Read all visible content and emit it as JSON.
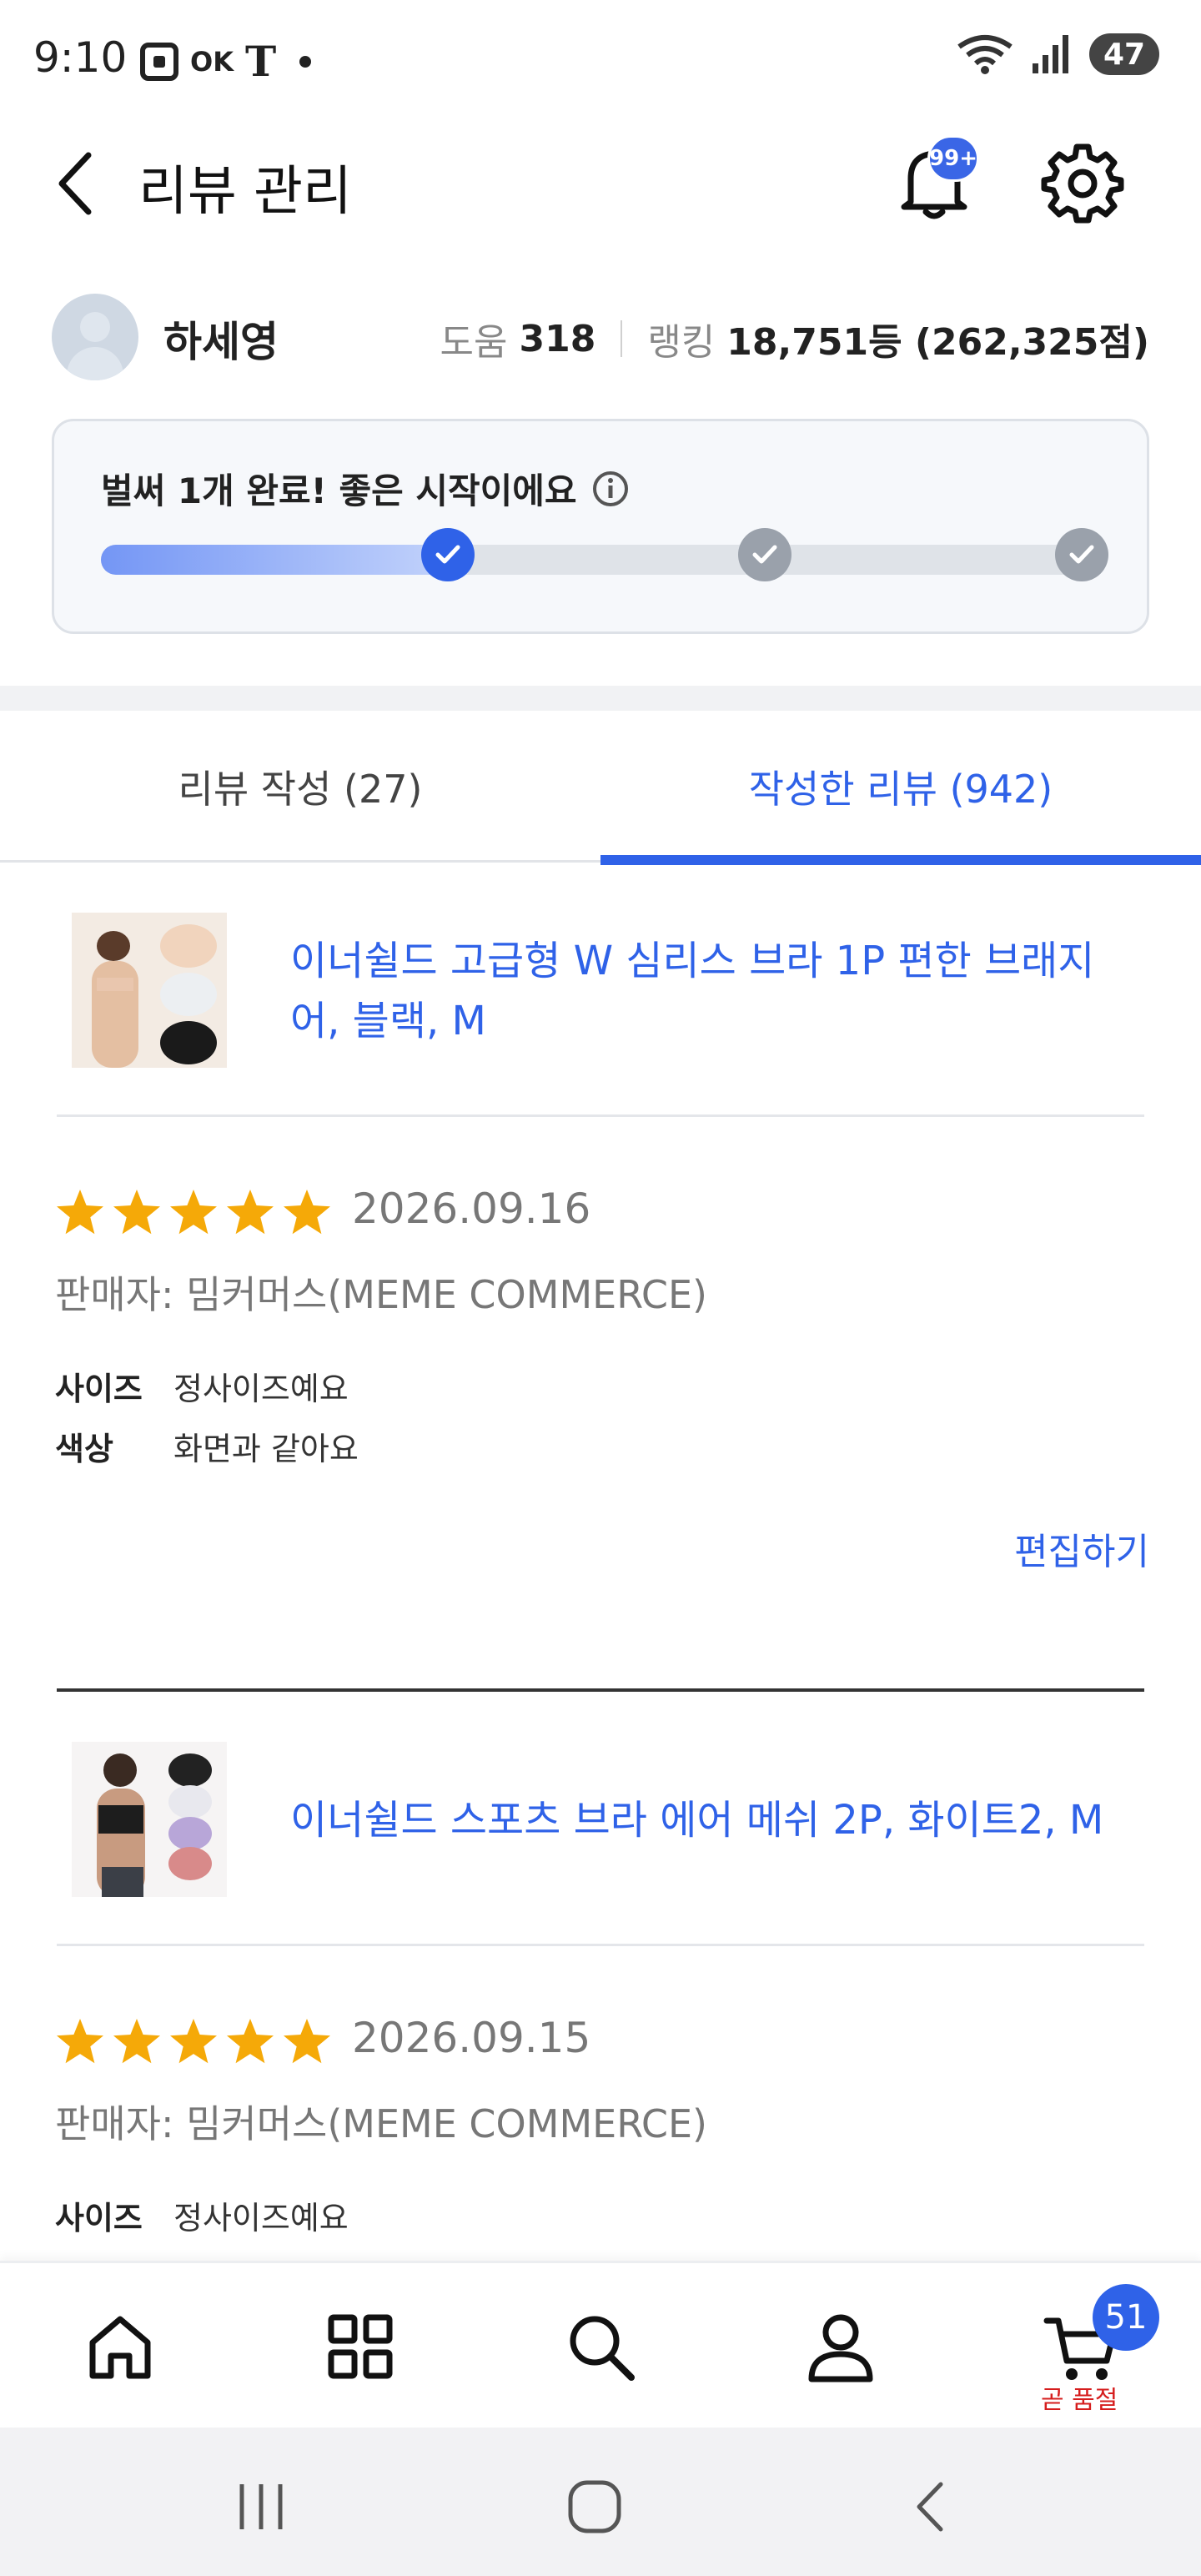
{
  "status_bar": {
    "time": "9:10",
    "icons_left": [
      "screenshot-icon",
      "ok-icon",
      "t-icon",
      "dot-icon"
    ],
    "ok_text": "OK",
    "t_text": "T",
    "battery": "47",
    "icons_right": [
      "wifi-icon",
      "signal-icon",
      "battery-icon"
    ]
  },
  "header": {
    "title": "리뷰 관리",
    "notification_badge": "99+"
  },
  "profile": {
    "name": "하세영",
    "help_label": "도움",
    "help_value": "318",
    "ranking_label": "랭킹",
    "ranking_value": "18,751등 (262,325점)"
  },
  "progress": {
    "message": "벌써 1개 완료! 좋은 시작이에요",
    "completed_steps": 1,
    "total_steps": 3,
    "fill_fraction": 0.35
  },
  "tabs": [
    {
      "label": "리뷰 작성 (27)",
      "active": false
    },
    {
      "label": "작성한 리뷰 (942)",
      "active": true
    }
  ],
  "reviews": [
    {
      "product_title": "이너쉴드 고급형 W 심리스 브라 1P 편한 브래지어, 블랙, M",
      "rating": 5,
      "date": "2026.09.16",
      "seller": "판매자: 밈커머스(MEME COMMERCE)",
      "attributes": [
        {
          "label": "사이즈",
          "value": "정사이즈예요"
        },
        {
          "label": "색상",
          "value": "화면과 같아요"
        }
      ],
      "edit_label": "편집하기"
    },
    {
      "product_title": "이너쉴드 스포츠 브라 에어 메쉬 2P, 화이트2, M",
      "rating": 5,
      "date": "2026.09.15",
      "seller": "판매자: 밈커머스(MEME COMMERCE)",
      "attributes": [
        {
          "label": "사이즈",
          "value": "정사이즈예요"
        }
      ]
    }
  ],
  "bottom_nav": {
    "items": [
      "home-icon",
      "category-icon",
      "search-icon",
      "my-page-icon",
      "cart-icon"
    ],
    "cart_count": "51",
    "cart_note": "곧 품절"
  },
  "colors": {
    "accent": "#2f62e8",
    "star": "#f5a908",
    "alert": "#d61e1e"
  }
}
